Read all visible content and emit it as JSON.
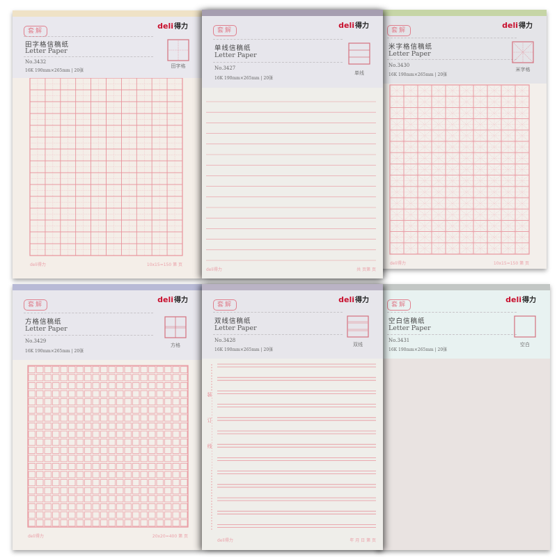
{
  "brand": {
    "logo_en": "deli",
    "logo_cn": "得力",
    "stamp": "套解"
  },
  "spec": "16K 190mm×265mm | 20张",
  "subtitle": "Letter Paper",
  "colors": {
    "ink_red": "#e8939c",
    "logo_red": "#c8102e"
  },
  "pads": [
    {
      "id": "tianzige",
      "title": "田字格信稿纸",
      "number": "No.3432",
      "icon": "tian-grid-icon",
      "icon_label": "田字格",
      "footer_left": "deli得力",
      "footer_right": "10x15=150   第   页",
      "cols": 10,
      "rows": 15,
      "strip": "#efe2c6",
      "header_bg": "#e9e8ee",
      "body_bg": "#f4eee8"
    },
    {
      "id": "danxian",
      "title": "单线信稿纸",
      "number": "No.3427",
      "icon": "single-line-icon",
      "icon_label": "单线",
      "footer_left": "deli得力",
      "footer_right": "共   页第   页",
      "lines": 16,
      "strip": "#a69eb0",
      "header_bg": "#e7e6ec",
      "body_bg": "#efeeea"
    },
    {
      "id": "mizige",
      "title": "米字格信稿纸",
      "number": "No.3430",
      "icon": "mi-grid-icon",
      "icon_label": "米字格",
      "footer_left": "deli得力",
      "footer_right": "10x15=150   第   页",
      "cols": 10,
      "rows": 15,
      "strip": "#c6d5a6",
      "header_bg": "#e4e4e8",
      "body_bg": "#f3efeb"
    },
    {
      "id": "fangge",
      "title": "方格信稿纸",
      "number": "No.3429",
      "icon": "square-grid-icon",
      "icon_label": "方格",
      "footer_left": "deli得力",
      "footer_right": "20x20=400   第   页",
      "cols": 20,
      "rows": 20,
      "strip": "#b8bad6",
      "header_bg": "#e8e7ed",
      "body_bg": "#f3efea"
    },
    {
      "id": "shuangxian",
      "title": "双线信稿纸",
      "number": "No.3428",
      "icon": "double-line-icon",
      "icon_label": "双线",
      "footer_left": "deli得力",
      "footer_right": "年  月  日  第   页",
      "margin_label": "装订线",
      "lines": 13,
      "strip": "#bab3c5",
      "header_bg": "#e7e6eb",
      "body_bg": "#efeeea"
    },
    {
      "id": "kongbai",
      "title": "空白信稿纸",
      "number": "No.3431",
      "icon": "blank-square-icon",
      "icon_label": "空白",
      "strip": "#c3c7c5",
      "header_bg": "#e8f2f1",
      "body_bg": "#e9e3e1"
    }
  ]
}
